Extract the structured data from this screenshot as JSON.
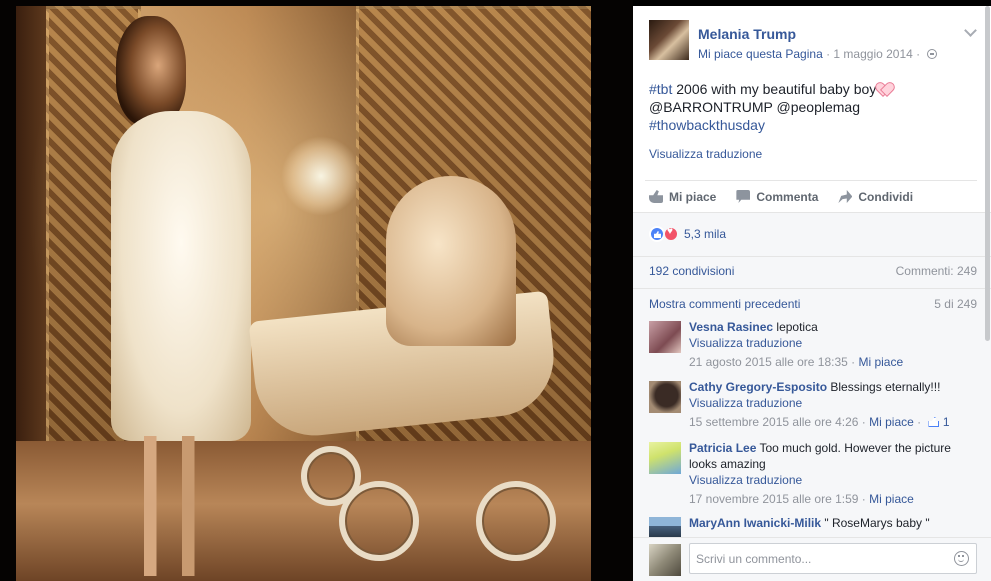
{
  "post": {
    "page_name": "Melania Trump",
    "like_page": "Mi piace questa Pagina",
    "separator": " · ",
    "date": "1 maggio 2014",
    "audience_separator": " · ",
    "text_tag1": "#tbt",
    "text_part1": " 2006 with my beautiful baby boy",
    "text_line2": "@BARRONTRUMP @peoplemag",
    "text_tag2": "#thowbackthusday",
    "translate": "Visualizza traduzione"
  },
  "actions": {
    "like": "Mi piace",
    "comment": "Commenta",
    "share": "Condividi"
  },
  "stats": {
    "reactions": "5,3 mila",
    "shares": "192 condivisioni",
    "comments": "Commenti: 249"
  },
  "comments": {
    "show_previous": "Mostra commenti precedenti",
    "counter": "5 di 249",
    "items": [
      {
        "author": "Vesna Rasinec",
        "text": "lepotica",
        "translate": "Visualizza traduzione",
        "timestamp": "21 agosto 2015 alle ore 18:35",
        "like": "Mi piace",
        "likes": ""
      },
      {
        "author": "Cathy Gregory-Esposito",
        "text": "Blessings eternally!!!",
        "translate": "Visualizza traduzione",
        "timestamp": "15 settembre 2015 alle ore 4:26",
        "like": "Mi piace",
        "likes": "1"
      },
      {
        "author": "Patricia Lee",
        "text": "Too much gold. However the picture looks amazing",
        "translate": "Visualizza traduzione",
        "timestamp": "17 novembre 2015 alle ore 1:59",
        "like": "Mi piace",
        "likes": ""
      },
      {
        "author": "MaryAnn Iwanicki-Milik",
        "text": "\" RoseMarys baby \""
      }
    ],
    "input_placeholder": "Scrivi un commento..."
  },
  "colors": {
    "link": "#365899",
    "muted": "#90949c",
    "like_blue": "#4c82f7",
    "love_red": "#f25268"
  }
}
